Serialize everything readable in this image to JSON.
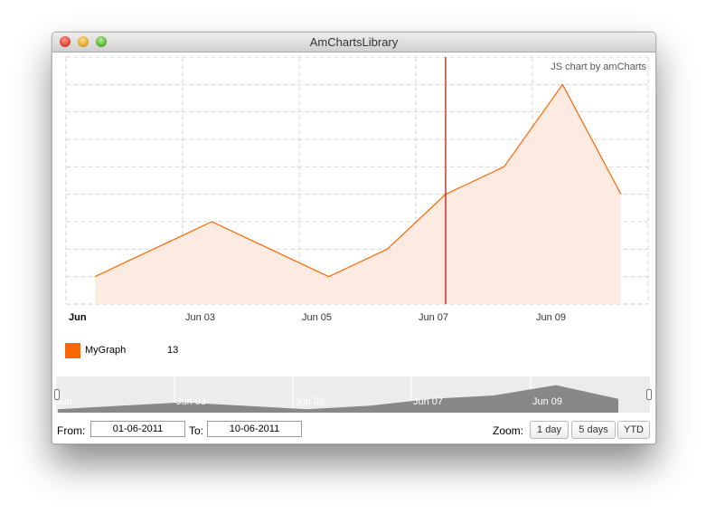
{
  "window": {
    "title": "AmChartsLibrary"
  },
  "chart": {
    "credit": "JS chart by amCharts",
    "x_labels": [
      "Jun",
      "Jun 03",
      "Jun 05",
      "Jun 07",
      "Jun 09"
    ],
    "legend": {
      "name": "MyGraph",
      "value": "13"
    },
    "scrollbar_labels": [
      "Jun",
      "Jun 03",
      "Jun 05",
      "Jun 07",
      "Jun 09"
    ]
  },
  "controls": {
    "from_label": "From:",
    "from_value": "01-06-2011",
    "to_label": "To:",
    "to_value": "10-06-2011",
    "zoom_label": "Zoom:",
    "zoom_buttons": [
      "1 day",
      "5 days",
      "YTD"
    ]
  },
  "chart_data": {
    "type": "area",
    "x": [
      "01-06-2011",
      "02-06-2011",
      "03-06-2011",
      "04-06-2011",
      "05-06-2011",
      "06-06-2011",
      "07-06-2011",
      "08-06-2011",
      "09-06-2011",
      "10-06-2011"
    ],
    "series": [
      {
        "name": "MyGraph",
        "values": [
          1,
          2,
          3,
          2,
          1,
          2,
          4,
          5,
          8,
          4
        ]
      }
    ],
    "ylim": [
      0,
      9
    ],
    "cursor_x": "07-06-2011",
    "legend_value": 13,
    "colors": {
      "line": "#ff6600",
      "fill": "#fdebe2",
      "cursor": "#cc0000",
      "grid": "#d6d6d6",
      "scroll_fill": "#888888"
    },
    "grid": true
  }
}
